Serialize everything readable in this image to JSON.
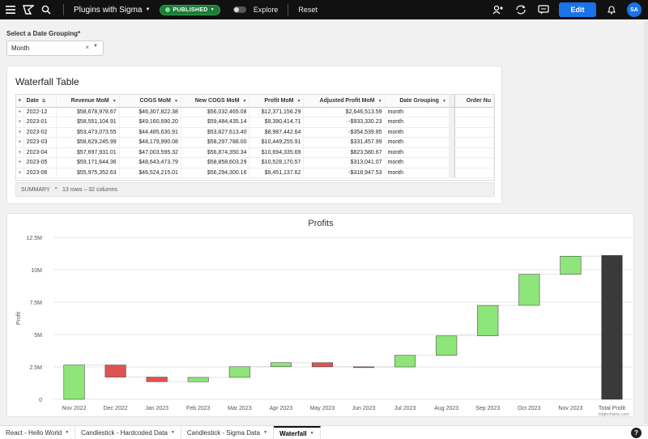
{
  "topbar": {
    "doc_title": "Plugins with Sigma",
    "status": "PUBLISHED",
    "explore": "Explore",
    "reset": "Reset",
    "edit": "Edit",
    "avatar": "SA"
  },
  "control": {
    "label": "Select a Date Grouping*",
    "value": "Month"
  },
  "table": {
    "title": "Waterfall Table",
    "columns": [
      "Date",
      "Revenue MoM",
      "COGS MoM",
      "New COGS MoM",
      "Profit MoM",
      "Adjusted Profit MoM",
      "Date Grouping",
      "Order Nu"
    ],
    "rows": [
      [
        "2022-12",
        "$58,678,978.67",
        "$46,307,822.38",
        "$56,032,465.08",
        "$12,371,156.29",
        "$2,646,513.59",
        "month"
      ],
      [
        "2023-01",
        "$58,551,104.91",
        "$49,160,690.20",
        "$59,484,435.14",
        "$9,390,414.71",
        "-$933,330.23",
        "month"
      ],
      [
        "2023-02",
        "$53,473,073.55",
        "$44,485,630.91",
        "$53,827,613.40",
        "$8,987,442.64",
        "-$354,539.85",
        "month"
      ],
      [
        "2023-03",
        "$58,629,245.99",
        "$48,179,990.08",
        "$58,297,788.00",
        "$10,449,255.91",
        "$331,457.99",
        "month"
      ],
      [
        "2023-04",
        "$57,697,931.01",
        "$47,003,595.32",
        "$56,874,350.34",
        "$10,694,335.69",
        "$823,580.67",
        "month"
      ],
      [
        "2023-05",
        "$59,171,644.36",
        "$48,643,473.79",
        "$58,858,603.29",
        "$10,528,170.57",
        "$313,041.07",
        "month"
      ],
      [
        "2023-06",
        "$55,975,352.63",
        "$46,524,215.01",
        "$56,294,300.16",
        "$9,451,137.62",
        "-$318,947.53",
        "month"
      ]
    ],
    "summary_label": "SUMMARY",
    "summary_info": "13 rows – 32 columns"
  },
  "chart_data": {
    "type": "bar",
    "subtype": "waterfall",
    "title": "Profits",
    "ylabel": "Profit",
    "xlabel": "",
    "ylim": [
      0,
      12500000
    ],
    "yticks": [
      "0",
      "2.5M",
      "5M",
      "7.5M",
      "10M",
      "12.5M"
    ],
    "categories": [
      "Nov 2022",
      "Dec 2022",
      "Jan 2023",
      "Feb 2023",
      "Mar 2023",
      "Apr 2023",
      "May 2023",
      "Jun 2023",
      "Jul 2023",
      "Aug 2023",
      "Sep 2023",
      "Oct 2023",
      "Nov 2023",
      "Total Profit"
    ],
    "values": [
      2646513.59,
      -933330.23,
      -354539.85,
      331457.99,
      823580.67,
      313041.07,
      -318947.53,
      -10000,
      900000,
      1500000,
      2350000,
      2400000,
      1400000,
      11100000
    ],
    "colors": {
      "positive": "#8ee57a",
      "negative": "#e05252",
      "total": "#3a3a3a",
      "zero": "#222222"
    },
    "credits": "Highcharts.com",
    "grid": true,
    "legend": "none"
  },
  "tabs": [
    {
      "label": "React - Hello World",
      "active": false
    },
    {
      "label": "Candlestick - Hardcoded Data",
      "active": false
    },
    {
      "label": "Candlestick - Sigma Data",
      "active": false
    },
    {
      "label": "Waterfall",
      "active": true
    }
  ],
  "help": "?"
}
